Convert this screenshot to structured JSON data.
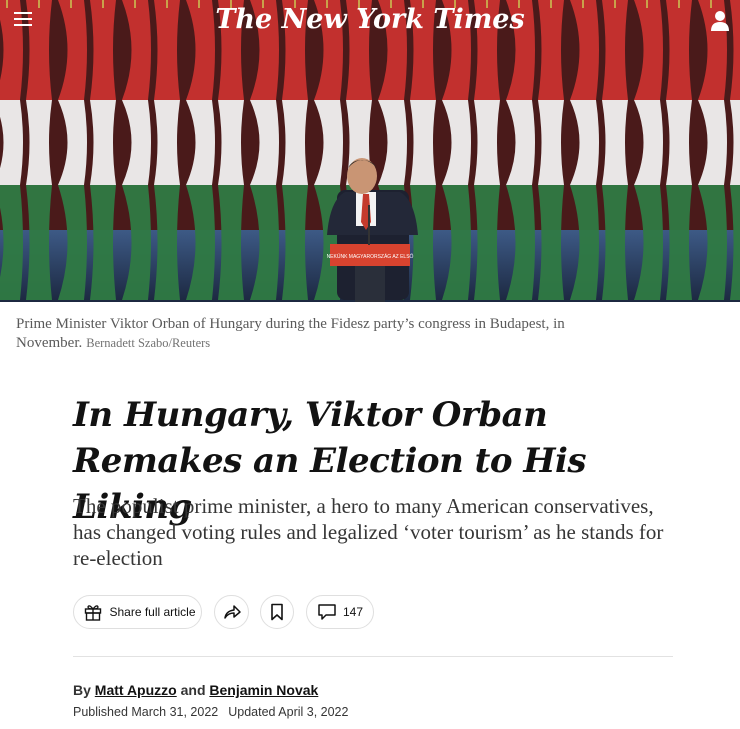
{
  "header": {
    "logo_text": "The New York Times"
  },
  "hero": {
    "podium_text": "NEKÜNK MAGYARORSZÁG AZ ELSŐ",
    "colors": {
      "red": "#c8322f",
      "white": "#f1f1f1",
      "green": "#2f7a43"
    }
  },
  "caption": {
    "text": "Prime Minister Viktor Orban of Hungary during the Fidesz party’s congress in Budapest, in November.",
    "credit": "Bernadett Szabo/Reuters"
  },
  "article": {
    "headline_line1": "In Hungary, Viktor Orban",
    "headline_line2": "Remakes an Election to His Liking",
    "summary": "The populist prime minister, a hero to many American conservatives, has changed voting rules and legalized ‘voter tourism’ as he stands for re-election"
  },
  "actions": {
    "share_full_label": "Share full article",
    "comment_count": "147"
  },
  "byline": {
    "prefix": "By",
    "author1": "Matt Apuzzo",
    "conjunction": "and",
    "author2": "Benjamin Novak",
    "published": "Published March 31, 2022",
    "updated": "Updated April 3, 2022"
  }
}
